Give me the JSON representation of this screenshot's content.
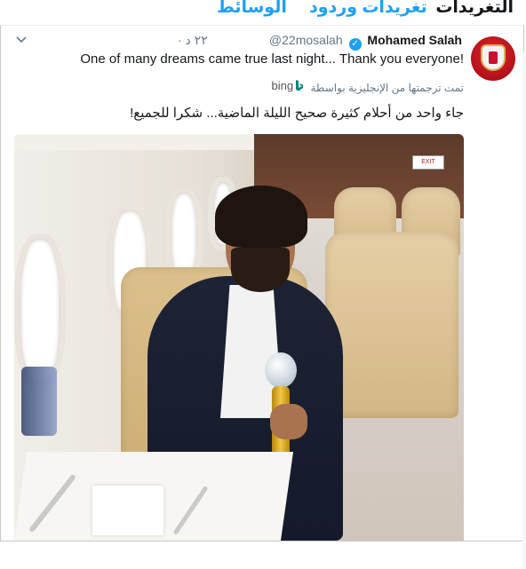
{
  "tabs": {
    "tweets": "التغريدات",
    "tweets_and_replies": "تغريدات وردود",
    "media": "الوسائط"
  },
  "tweet": {
    "display_name": "Mohamed Salah",
    "handle": "@22mosalah",
    "time": "٢٢ د ·",
    "text_en": "One of many dreams came true last night... Thank you everyone!",
    "translated_by": "تمت ترجمتها من الإنجليزية بواسطة",
    "translator": "bing",
    "text_ar": "جاء واحد من أحلام كثيرة صحيح الليلة الماضية... شكرا للجميع!",
    "exit_sign": "EXIT"
  },
  "colors": {
    "accent": "#1da1f2",
    "text": "#14171a",
    "muted": "#657786"
  },
  "icons": {
    "verified": "verified-badge-icon",
    "caret": "chevron-down-icon",
    "translator": "bing-logo-icon"
  }
}
